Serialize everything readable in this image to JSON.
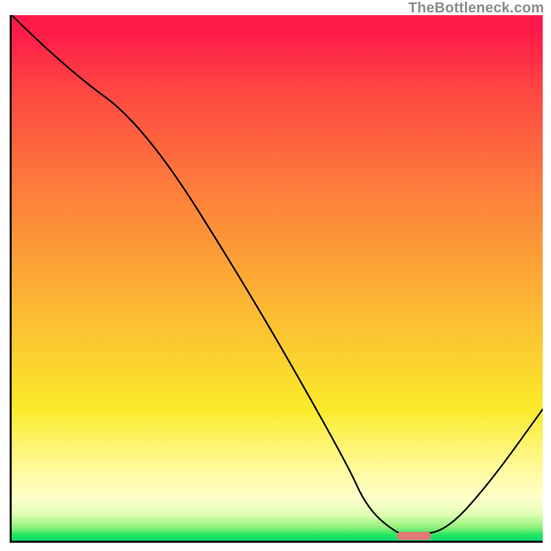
{
  "watermark": "TheBottleneck.com",
  "chart_data": {
    "type": "line",
    "title": "",
    "xlabel": "",
    "ylabel": "",
    "xlim": [
      0,
      100
    ],
    "ylim": [
      0,
      100
    ],
    "grid": false,
    "series": [
      {
        "name": "curve",
        "x": [
          0,
          10,
          25,
          45,
          63,
          67,
          73,
          76,
          82,
          90,
          100
        ],
        "y": [
          100,
          90,
          79,
          47,
          15,
          6,
          1,
          1,
          2,
          11,
          25
        ]
      }
    ],
    "marker": {
      "name": "optimum-marker",
      "x_start": 72.5,
      "x_end": 79,
      "y": 0.9,
      "color": "#e07a76"
    },
    "background_gradient": {
      "type": "vertical",
      "stops": [
        {
          "pos": 0.0,
          "color": "#ff1a49"
        },
        {
          "pos": 0.32,
          "color": "#fd7a3c"
        },
        {
          "pos": 0.63,
          "color": "#fbcb30"
        },
        {
          "pos": 0.88,
          "color": "#fffccf"
        },
        {
          "pos": 0.99,
          "color": "#1ee660"
        }
      ]
    }
  }
}
